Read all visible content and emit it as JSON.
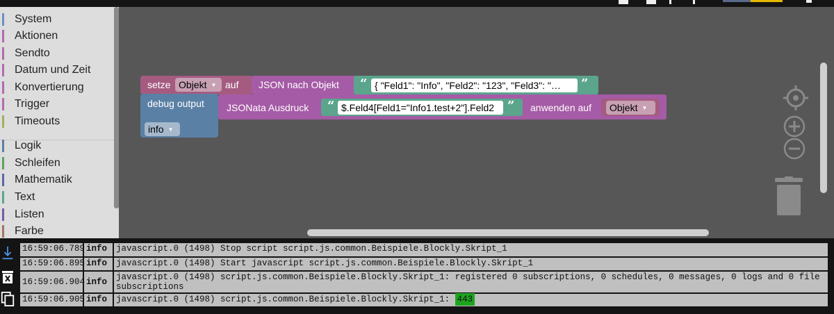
{
  "toolbox": {
    "categories": [
      {
        "label": "System",
        "color": "#6b8fc4"
      },
      {
        "label": "Aktionen",
        "color": "#b26bb1"
      },
      {
        "label": "Sendto",
        "color": "#b26bb1"
      },
      {
        "label": "Datum und Zeit",
        "color": "#b26bb1"
      },
      {
        "label": "Konvertierung",
        "color": "#b26bb1"
      },
      {
        "label": "Trigger",
        "color": "#b26bb1"
      },
      {
        "label": "Timeouts",
        "color": "#a0b060"
      },
      {
        "label": "Logik",
        "color": "#5b80a5"
      },
      {
        "label": "Schleifen",
        "color": "#5ba55b"
      },
      {
        "label": "Mathematik",
        "color": "#5b67a5"
      },
      {
        "label": "Text",
        "color": "#5ba58c"
      },
      {
        "label": "Listen",
        "color": "#745ba5"
      },
      {
        "label": "Farbe",
        "color": "#a5745b"
      }
    ]
  },
  "blocks": {
    "set_block": {
      "label_setze": "setze",
      "variable": "Objekt",
      "label_auf": "auf",
      "color": "#a55b80"
    },
    "json_to_object": {
      "label": "JSON nach Objekt",
      "color": "#a55ba5"
    },
    "json_string": {
      "value": "{ \"Feld1\": \"Info\",  \"Feld2\": \"123\",  \"Feld3\": \"…",
      "color": "#5ba58c"
    },
    "debug_block": {
      "label": "debug output",
      "level": "info",
      "color": "#5b80a5"
    },
    "jsonata_block": {
      "label": "JSONata Ausdruck",
      "label_apply": "anwenden auf",
      "color": "#a55ba5"
    },
    "jsonata_string": {
      "value": "$.Feld4[Feld1=\"Info1.test+2\"].Feld2"
    },
    "object_variable": {
      "variable": "Objekt",
      "color": "#a55b80"
    }
  },
  "log": {
    "rows": [
      {
        "time": "16:59:06.789",
        "level": "info",
        "message": "javascript.0 (1498) Stop script script.js.common.Beispiele.Blockly.Skript_1",
        "highlight": ""
      },
      {
        "time": "16:59:06.895",
        "level": "info",
        "message": "javascript.0 (1498) Start javascript script.js.common.Beispiele.Blockly.Skript_1",
        "highlight": ""
      },
      {
        "time": "16:59:06.904",
        "level": "info",
        "message": "javascript.0 (1498) script.js.common.Beispiele.Blockly.Skript_1: registered 0 subscriptions, 0 schedules, 0 messages, 0 logs and 0 file subscriptions",
        "highlight": ""
      },
      {
        "time": "16:59:06.905",
        "level": "info",
        "message": "javascript.0 (1498) script.js.common.Beispiele.Blockly.Skript_1: ",
        "highlight": "443"
      }
    ],
    "highlight_color": "#1ea51e"
  },
  "icons": {
    "log_download": "download-icon",
    "log_clear": "trash-icon",
    "log_copy": "copy-icon",
    "center": "crosshair-icon",
    "zoom_in": "zoom-in-icon",
    "zoom_out": "zoom-out-icon",
    "trash": "trash-can-icon"
  }
}
